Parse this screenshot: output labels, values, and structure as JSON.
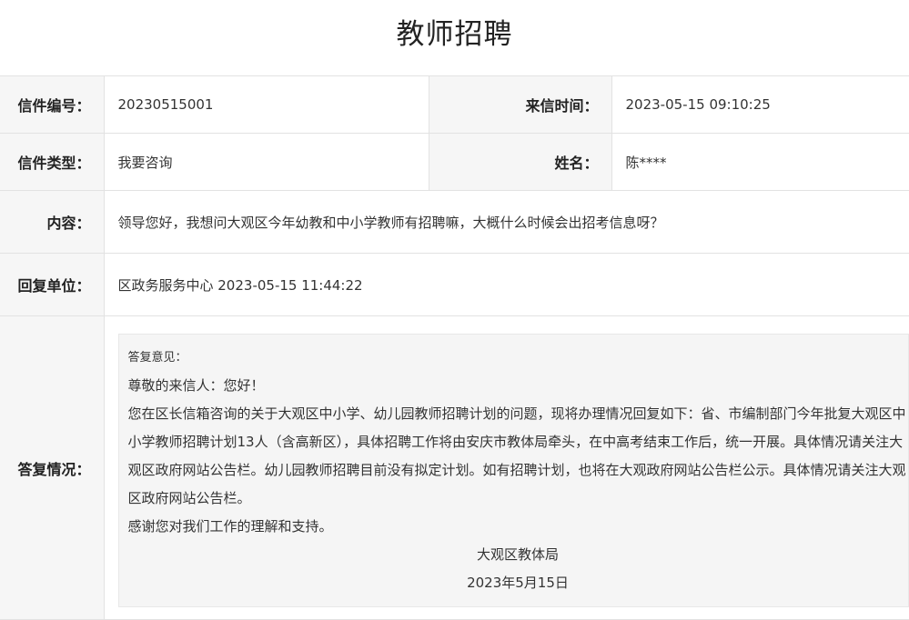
{
  "page": {
    "title": "教师招聘"
  },
  "letter": {
    "number_label": "信件编号：",
    "number": "20230515001",
    "time_label": "来信时间：",
    "time": "2023-05-15 09:10:25",
    "type_label": "信件类型：",
    "type": "我要咨询",
    "name_label": "姓名：",
    "name": "陈****",
    "content_label": "内容：",
    "content": "领导您好，我想问大观区今年幼教和中小学教师有招聘嘛，大概什么时候会出招考信息呀？",
    "reply_unit_label": "回复单位：",
    "reply_unit": "区政务服务中心 2023-05-15 11:44:22",
    "reply_label": "答复情况："
  },
  "reply": {
    "heading": "答复意见：",
    "greeting": "尊敬的来信人：您好！",
    "body": "您在区长信箱咨询的关于大观区中小学、幼儿园教师招聘计划的问题，现将办理情况回复如下：省、市编制部门今年批复大观区中小学教师招聘计划13人（含高新区），具体招聘工作将由安庆市教体局牵头，在中高考结束工作后，统一开展。具体情况请关注大观区政府网站公告栏。幼儿园教师招聘目前没有拟定计划。如有招聘计划，也将在大观政府网站公告栏公示。具体情况请关注大观区政府网站公告栏。",
    "thanks": "感谢您对我们工作的理解和支持。",
    "signature": "大观区教体局",
    "date": "2023年5月15日"
  }
}
